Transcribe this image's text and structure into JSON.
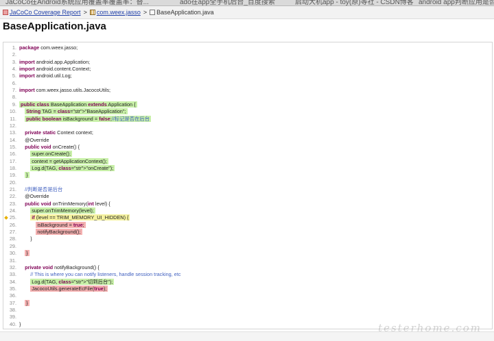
{
  "browser": {
    "tabs": [
      "JaCoCo在Android系统应用覆盖率覆盖率：替...",
      "ado在app全手机后台_百度搜索",
      "启动大机app - toy(原)等社 - CSDN博客",
      "android app判断应用是否"
    ]
  },
  "breadcrumb": [
    {
      "label": "JaCoCo Coverage Report",
      "icon": "report-icon"
    },
    {
      "label": "com.weex.jasso",
      "icon": "package-icon"
    },
    {
      "label": "BaseApplication.java",
      "icon": "source-icon"
    }
  ],
  "title": "BaseApplication.java",
  "watermark": "testerhome.com",
  "coverage_colors": {
    "covered": "#c8f0a8",
    "not_covered": "#f4b0b0",
    "partial": "#f5f2a0"
  },
  "lines": [
    {
      "n": "1.",
      "text": "package com.weex.jasso;",
      "cov": ""
    },
    {
      "n": "2.",
      "text": "",
      "cov": ""
    },
    {
      "n": "3.",
      "text": "import android.app.Application;",
      "cov": ""
    },
    {
      "n": "4.",
      "text": "import android.content.Context;",
      "cov": ""
    },
    {
      "n": "5.",
      "text": "import android.util.Log;",
      "cov": ""
    },
    {
      "n": "6.",
      "text": "",
      "cov": ""
    },
    {
      "n": "7.",
      "text": "import com.weex.jasso.utils.JacocoUtils;",
      "cov": ""
    },
    {
      "n": "8.",
      "text": "",
      "cov": ""
    },
    {
      "n": "9.",
      "text": "public class BaseApplication extends Application {",
      "cov": "fc"
    },
    {
      "n": "10.",
      "text": "    String TAG = \"BaseApplication\";",
      "cov": "fc"
    },
    {
      "n": "11.",
      "text": "    public boolean isBackground = false;//标记是否在后台",
      "cov": "fc"
    },
    {
      "n": "12.",
      "text": "",
      "cov": ""
    },
    {
      "n": "13.",
      "text": "    private static Context context;",
      "cov": ""
    },
    {
      "n": "14.",
      "text": "    @Override",
      "cov": ""
    },
    {
      "n": "15.",
      "text": "    public void onCreate() {",
      "cov": ""
    },
    {
      "n": "16.",
      "text": "        super.onCreate();",
      "cov": "fc"
    },
    {
      "n": "17.",
      "text": "        context = getApplicationContext();",
      "cov": "fc"
    },
    {
      "n": "18.",
      "text": "        Log.d(TAG, \"onCreate\");",
      "cov": "fc"
    },
    {
      "n": "19.",
      "text": "    }",
      "cov": "fc"
    },
    {
      "n": "20.",
      "text": "",
      "cov": ""
    },
    {
      "n": "21.",
      "text": "    //判断是否是后台",
      "cov": ""
    },
    {
      "n": "22.",
      "text": "    @Override",
      "cov": ""
    },
    {
      "n": "23.",
      "text": "    public void onTrimMemory(int level) {",
      "cov": ""
    },
    {
      "n": "24.",
      "text": "        super.onTrimMemory(level);",
      "cov": "fc"
    },
    {
      "n": "25.",
      "text": "        if (level == TRIM_MEMORY_UI_HIDDEN) {",
      "cov": "pc",
      "branch": true
    },
    {
      "n": "26.",
      "text": "            isBackground = true;",
      "cov": "nc"
    },
    {
      "n": "27.",
      "text": "            notifyBackground();",
      "cov": "nc"
    },
    {
      "n": "28.",
      "text": "        }",
      "cov": ""
    },
    {
      "n": "29.",
      "text": "",
      "cov": ""
    },
    {
      "n": "30.",
      "text": "    }",
      "cov": "nc"
    },
    {
      "n": "31.",
      "text": "",
      "cov": ""
    },
    {
      "n": "32.",
      "text": "    private void notifyBackground() {",
      "cov": ""
    },
    {
      "n": "33.",
      "text": "        // This is where you can notify listeners, handle session tracking, etc",
      "cov": ""
    },
    {
      "n": "34.",
      "text": "        Log.d(TAG, \"切到后台\");",
      "cov": "fc"
    },
    {
      "n": "35.",
      "text": "        JacocoUtils.generateEcFile(true);",
      "cov": "nc"
    },
    {
      "n": "36.",
      "text": "",
      "cov": ""
    },
    {
      "n": "37.",
      "text": "    }",
      "cov": "nc"
    },
    {
      "n": "38.",
      "text": "",
      "cov": ""
    },
    {
      "n": "39.",
      "text": "",
      "cov": ""
    },
    {
      "n": "40.",
      "text": "}",
      "cov": ""
    }
  ]
}
